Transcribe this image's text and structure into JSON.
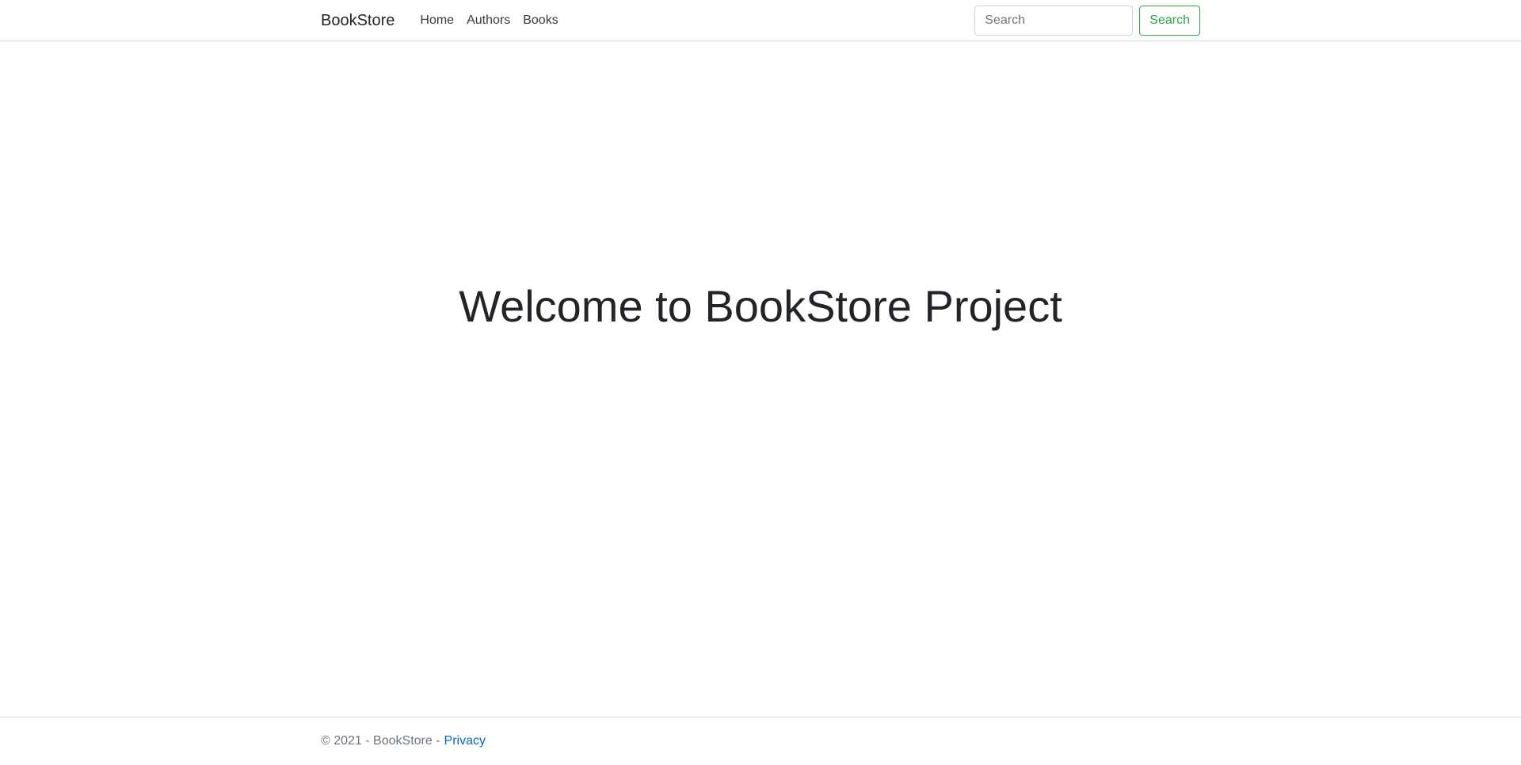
{
  "navbar": {
    "brand": "BookStore",
    "links": [
      {
        "label": "Home"
      },
      {
        "label": "Authors"
      },
      {
        "label": "Books"
      }
    ],
    "search": {
      "placeholder": "Search",
      "value": "",
      "button_label": "Search"
    }
  },
  "main": {
    "heading": "Welcome to BookStore Project"
  },
  "footer": {
    "text": "© 2021 - BookStore -",
    "privacy_label": "Privacy"
  },
  "colors": {
    "accent_success": "#28a745",
    "link": "#0366d6",
    "muted_text": "#6c757d",
    "border": "#dee2e6"
  }
}
